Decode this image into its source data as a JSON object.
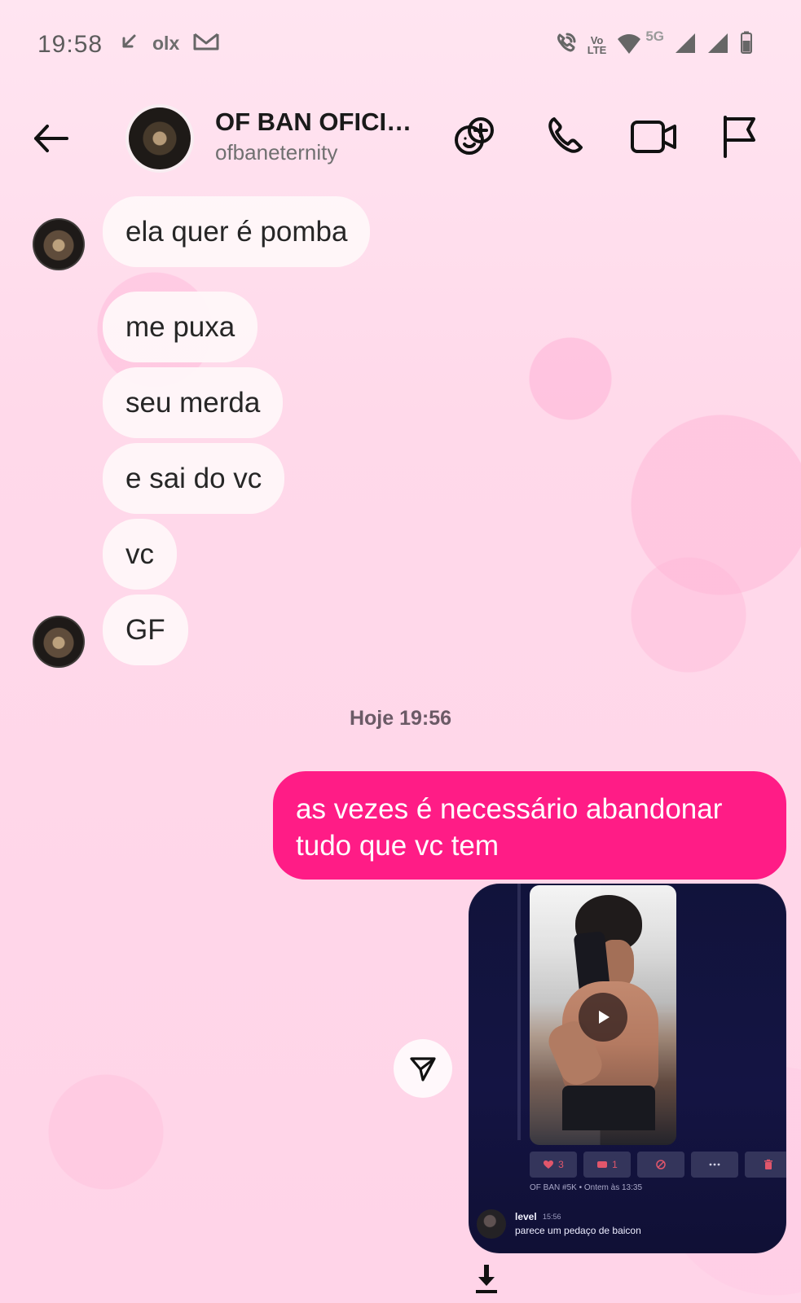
{
  "status_bar": {
    "time": "19:58",
    "left_icons": [
      "download-arrow-icon",
      "olx-icon",
      "gmail-icon"
    ],
    "olx_text": "olx",
    "vo_text": "Vo",
    "lte_text": "LTE",
    "signal_text": "5G"
  },
  "header": {
    "name": "OF BAN OFICI…",
    "username": "ofbaneternity"
  },
  "messages": [
    {
      "text": "ela quer é pomba"
    },
    {
      "text": "me puxa"
    },
    {
      "text": "seu merda"
    },
    {
      "text": "e sai do vc"
    },
    {
      "text": "vc"
    },
    {
      "text": "GF"
    }
  ],
  "divider": "Hoje 19:56",
  "outgoing": {
    "text": "as vezes é necessário abandonar tudo que vc tem"
  },
  "media": {
    "like_count": "3",
    "second_count": "1",
    "meta": "OF BAN #5K • Ontem às 13:35",
    "comment_user": "level",
    "comment_time": "15:56",
    "comment_text": "parece um pedaço de baicon"
  },
  "colors": {
    "outgoing_bubble": "#ff1c86",
    "incoming_bubble": "#fff7f9",
    "media_card": "#141443"
  }
}
